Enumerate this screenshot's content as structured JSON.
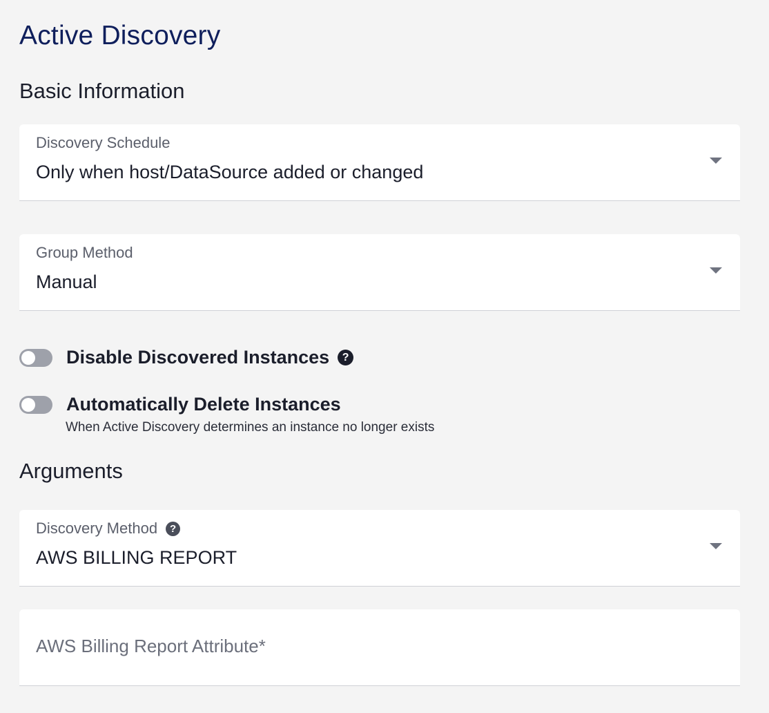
{
  "page": {
    "title": "Active Discovery"
  },
  "basic_information": {
    "title": "Basic Information",
    "discovery_schedule": {
      "label": "Discovery Schedule",
      "value": "Only when host/DataSource added or changed"
    },
    "group_method": {
      "label": "Group Method",
      "value": "Manual"
    },
    "disable_discovered_instances": {
      "label": "Disable Discovered Instances",
      "enabled": false,
      "help_icon": "question-circle-icon"
    },
    "auto_delete_instances": {
      "label": "Automatically Delete Instances",
      "description": "When Active Discovery determines an instance no longer exists",
      "enabled": false
    }
  },
  "arguments": {
    "title": "Arguments",
    "discovery_method": {
      "label": "Discovery Method",
      "value": "AWS BILLING REPORT",
      "help_icon": "question-circle-icon"
    },
    "aws_billing_report_attribute": {
      "label": "AWS Billing Report Attribute*",
      "value": ""
    }
  },
  "colors": {
    "background": "#f4f4f4",
    "title": "#0f1f5c",
    "toggle_off": "#9ea1aa"
  }
}
